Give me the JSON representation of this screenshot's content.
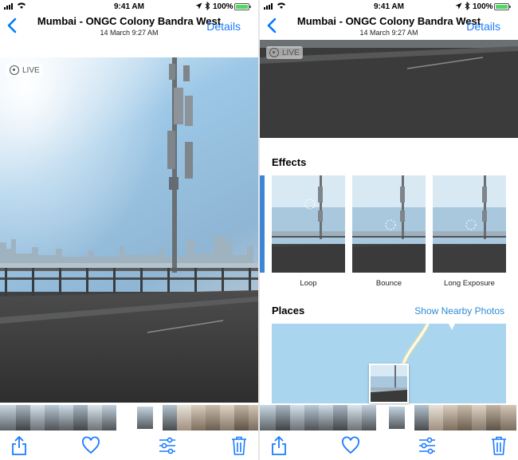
{
  "status_bar": {
    "time": "9:41 AM",
    "battery": "100%"
  },
  "nav": {
    "title": "Mumbai - ONGC Colony Bandra West",
    "subtitle": "14 March  9:27 AM",
    "details_label": "Details"
  },
  "photo": {
    "live_label": "LIVE"
  },
  "details": {
    "effects_heading": "Effects",
    "effects": [
      {
        "label": "Loop"
      },
      {
        "label": "Bounce"
      },
      {
        "label": "Long Exposure"
      }
    ],
    "places_heading": "Places",
    "show_nearby_label": "Show Nearby Photos"
  },
  "toolbar": {
    "icons": [
      "share-icon",
      "heart-icon",
      "adjust-sliders-icon",
      "trash-icon"
    ]
  },
  "colors": {
    "accent": "#1a7cff",
    "battery": "#4cd964",
    "map_water": "#a9d5ef"
  }
}
